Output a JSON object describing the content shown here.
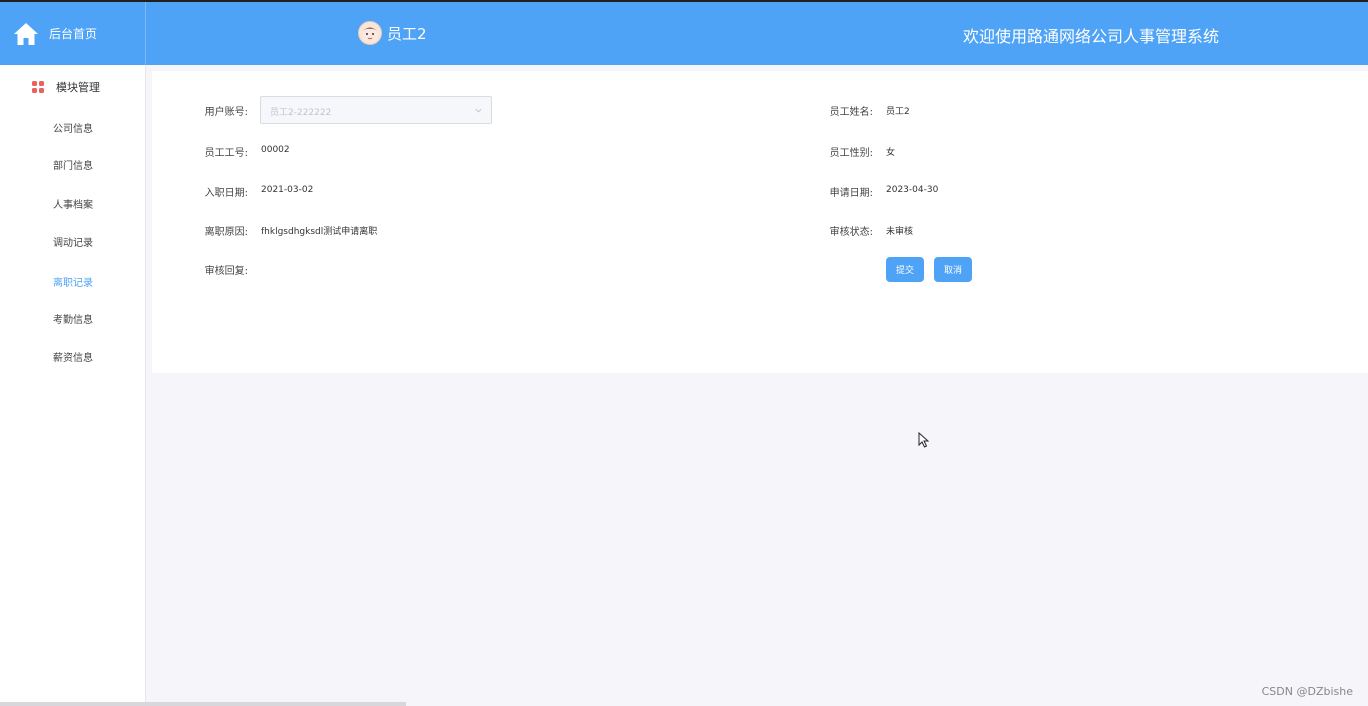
{
  "header": {
    "home_label": "后台首页",
    "user_name": "员工2",
    "welcome": "欢迎使用路通网络公司人事管理系统"
  },
  "sidebar": {
    "title": "模块管理",
    "items": [
      {
        "label": "公司信息"
      },
      {
        "label": "部门信息"
      },
      {
        "label": "人事档案"
      },
      {
        "label": "调动记录"
      },
      {
        "label": "离职记录",
        "active": true
      },
      {
        "label": "考勤信息"
      },
      {
        "label": "薪资信息"
      }
    ]
  },
  "form": {
    "account_label": "用户账号:",
    "account_value": "员工2-222222",
    "name_label": "员工姓名:",
    "name_value": "员工2",
    "employee_no_label": "员工工号:",
    "employee_no_value": "00002",
    "gender_label": "员工性别:",
    "gender_value": "女",
    "hire_date_label": "入职日期:",
    "hire_date_value": "2021-03-02",
    "apply_date_label": "申请日期:",
    "apply_date_value": "2023-04-30",
    "reason_label": "离职原因:",
    "reason_value": "fhklgsdhgksdl测试申请离职",
    "status_label": "审核状态:",
    "status_value": "未审核",
    "reply_label": "审核回复:",
    "submit_label": "提交",
    "cancel_label": "取消"
  },
  "watermark": "CSDN @DZbishe",
  "colors": {
    "primary": "#4fa3f7",
    "background": "#f5f5fa"
  }
}
